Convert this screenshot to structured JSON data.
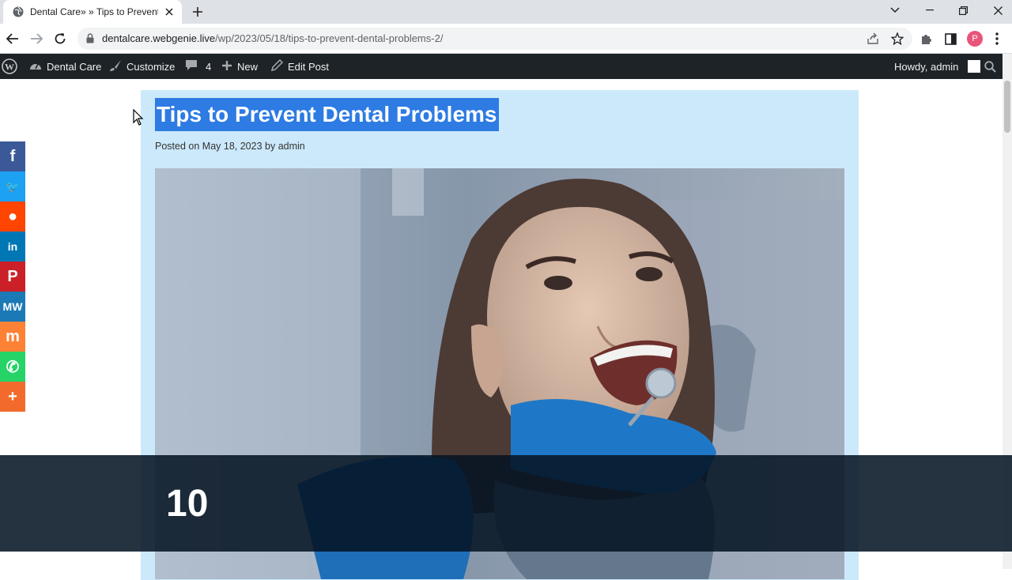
{
  "browser": {
    "tab_title": "Dental Care» » Tips to Prevent De",
    "url_host": "dentalcare.webgenie.live",
    "url_path": "/wp/2023/05/18/tips-to-prevent-dental-problems-2/",
    "profile_initial": "P"
  },
  "adminbar": {
    "site_name": "Dental Care",
    "customize": "Customize",
    "comments_count": "4",
    "new": "New",
    "edit_post": "Edit Post",
    "howdy": "Howdy, admin"
  },
  "post": {
    "title": "Tips to Prevent Dental Problems",
    "meta_prefix": "Posted on",
    "date": "May 18, 2023",
    "meta_by": "by",
    "author": "admin"
  },
  "share": [
    {
      "icon": "facebook-icon",
      "glyph": "f",
      "color": "#3b5998"
    },
    {
      "icon": "twitter-icon",
      "glyph": "🐦",
      "color": "#1da1f2"
    },
    {
      "icon": "reddit-icon",
      "glyph": "●",
      "color": "#ff4500"
    },
    {
      "icon": "linkedin-icon",
      "glyph": "in",
      "color": "#0077b5"
    },
    {
      "icon": "pinterest-icon",
      "glyph": "P",
      "color": "#cb2027"
    },
    {
      "icon": "mewe-icon",
      "glyph": "MW",
      "color": "#1b79b6"
    },
    {
      "icon": "mix-icon",
      "glyph": "m",
      "color": "#fd8235"
    },
    {
      "icon": "whatsapp-icon",
      "glyph": "✆",
      "color": "#25d366"
    },
    {
      "icon": "more-share-icon",
      "glyph": "+",
      "color": "#f26b2c"
    }
  ],
  "overlay": {
    "number": "10"
  }
}
